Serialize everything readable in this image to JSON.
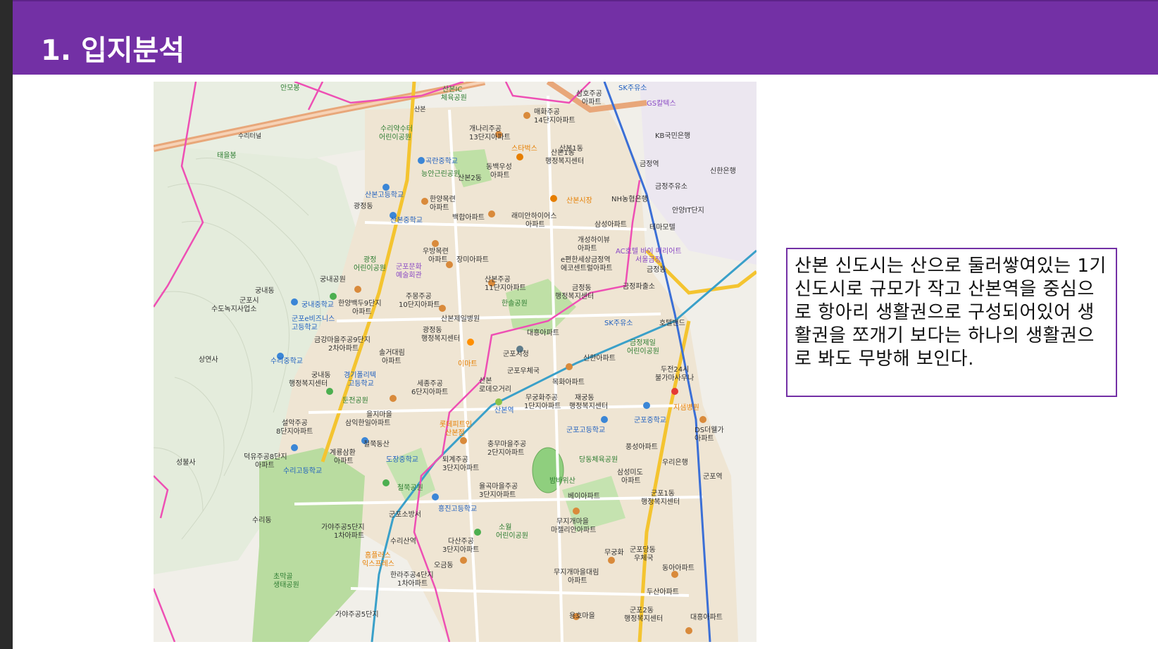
{
  "slide": {
    "title": "1. 입지분석",
    "description": "산본 신도시는 산으로 둘러쌓여있는 1기 신도시로 규모가 작고 산본역을 중심으로 항아리 생활권으로 구성되어있어 생활권을 쪼개기 보다는 하나의 생활권으로 봐도 무방해 보인다."
  },
  "map": {
    "labels": {
      "sanbon_ic": "산본IC",
      "sanbon_ic_park": "체육공원",
      "maehwa14": "매화주공",
      "maehwa14b": "14단지아파트",
      "gaenari13": "개나리주공",
      "gaenari13b": "13단지아파트",
      "sanbon1dong": "산본1동",
      "sanbon1center": "산본1동",
      "sanbon1center_b": "행정복지센터",
      "starbucks": "스타벅스",
      "gokran_ms": "곡란중학교",
      "dongbaek": "동백우성",
      "dongbaek_b": "아파트",
      "sanbon2dong": "산본2동",
      "neungan_park": "능안근린공원",
      "sanbon_hs": "산본고등학교",
      "hanyang": "한양목련",
      "hanyang_b": "아파트",
      "gwangjeong": "광정동",
      "sanbon_ms": "산본중학교",
      "baekhap": "백합아파트",
      "raemian": "래미안하이어스",
      "raemian_b": "아파트",
      "sanbon_market": "산본시장",
      "nh_bank": "NH농협은행",
      "samsung_apt": "삼성아파트",
      "temamotel": "테마모텔",
      "geumjeong_station": "금정역",
      "kb_bank": "KB국민은행",
      "sk_gas": "SK주유소",
      "gs_caltex": "GS칼텍스",
      "shinhan": "신한은행",
      "anyang_it": "안양IT단지",
      "woobang": "우방목련",
      "woobang_b": "아파트",
      "jangmi": "장미아파트",
      "gwangjeong_park": "광정",
      "gwangjeong_park_b": "어린이공원",
      "gunpo_culture": "군포문화",
      "gunpo_culture_b": "예술회관",
      "gungnae_park": "궁내공원",
      "gungnae_dong": "궁내동",
      "gunpo_office": "군포시",
      "gunpo_office_b": "수도녹지사업소",
      "gungnae_ms": "궁내중학교",
      "hanyang9": "한양백두9단지",
      "hanyang9_b": "아파트",
      "jumong10": "주몽주공",
      "jumong10_b": "10단지아파트",
      "sanbon11": "산본주공",
      "sanbon11_b": "11단지아파트",
      "hansol_park": "한솔공원",
      "geumjeong_dong": "금정동",
      "geumjeong_center": "행정복지센터",
      "gunpo_e_biz": "군포e비즈니스",
      "gunpo_e_biz_b": "고등학교",
      "sanbon_hospital": "산본제일병원",
      "geumgang9": "금강마을주공9단지",
      "geumgang9_b": "2차아파트",
      "gwangjeong_center": "광정동",
      "gwangjeong_center_b": "행정복지센터",
      "daeheung": "대흥아파트",
      "sangyeonsa": "상연사",
      "suri_ms": "수리중학교",
      "solgeo": "솔거대림",
      "solgeo_b": "아파트",
      "emart": "이마트",
      "gunpo_cityhall": "군포시청",
      "gunpo_post": "군포우체국",
      "shinhwa": "신한아파트",
      "sk_gas2": "SK주유소",
      "hotel": "호텔밴드",
      "gyeonggi_poly": "경기폴리텍",
      "gyeonggi_poly_b": "고등학교",
      "gungnae_center": "궁내동",
      "gungnae_center_b": "행정복지센터",
      "sejong6": "세종주공",
      "sejong6_b": "6단지아파트",
      "sanbon_lotte": "산본",
      "sanbon_lotte_b": "로데오거리",
      "mokhwa": "목화아파트",
      "dunjeon_park": "둔전공원",
      "eulji": "을지마을",
      "eulji_b": "삼익한일아파트",
      "sanbon_station": "산본역",
      "mugunghwa1": "무궁화주공",
      "mugunghwa1_b": "1단지아파트",
      "jaegung_center": "재궁동",
      "jaegung_center_b": "행정복지센터",
      "gunpo_hs": "군포고등학교",
      "gunpo_ms": "군포중학교",
      "jisaem": "지샘병원",
      "ds_apt": "DS더웰가",
      "ds_apt_b": "아파트",
      "seolak8": "설악주공",
      "seolak8_b": "8단지아파트",
      "lotte_fit": "롯데피트인",
      "lotte_fit_b": "산본점",
      "cheolchuk": "철쭉동산",
      "dojang_ms": "도장중학교",
      "chungmu2": "충무마을주공",
      "chungmu2_b": "2단지아파트",
      "pungseong": "풍성아파트",
      "dangdong_park": "당동체육공원",
      "woori": "우리은행",
      "seongbulsa": "성불사",
      "deokyu8": "덕유주공8단지",
      "deokyu8_b": "아파트",
      "suri_hs": "수리고등학교",
      "gyeryong": "계룡삼환",
      "gyeryong_b": "아파트",
      "toegye3": "퇴계주공",
      "toegye3_b": "3단지아파트",
      "sammido": "삼성미도",
      "sammido_b": "아파트",
      "gunpo_station": "군포역",
      "cheoljuk_park": "철쭉공원",
      "yulgok3": "율곡마을주공",
      "yulgok3_b": "3단지아파트",
      "bambwisan": "밤바위산",
      "bei_apt": "베이아파트",
      "gunpo1_center": "군포1동",
      "gunpo1_center_b": "행정복지센터",
      "suridong": "수리동",
      "gunpo_fire": "군포소방서",
      "heungjin_hs": "흥진고등학교",
      "gaya5": "가야주공5단지",
      "gaya5_b": "1차아파트",
      "surisan_station": "수리산역",
      "soweol_park": "소월",
      "soweol_park_b": "어린이공원",
      "mujigae": "무지개마을",
      "mujigae_b": "마젤리안아파트",
      "dasan3": "다산주공",
      "dasan3_b": "3단지아파트",
      "homeplus": "홈플러스",
      "homeplus_b": "익스프레스",
      "ogeum": "오금동",
      "mugunghwa": "무궁화",
      "gunpo_dangdong": "군포당동",
      "gunpo_dangdong_b": "우체국",
      "donga": "동아아파트",
      "choman_park": "초막골",
      "choman_park_b": "생태공원",
      "halla4": "한라주공4단지",
      "halla4_b": "1차아파트",
      "mujigae_daelim": "무지개마을대림",
      "mujigae_daelim_b": "아파트",
      "dusan": "두산아파트",
      "gaya5_2": "가야주공5단지",
      "yongho": "용호마을",
      "gunpo2_center": "군포2동",
      "gunpo2_center_b": "행정복지센터",
      "daeheung2": "대흥아파트",
      "ac_hotel": "AC호텔 바이 메리어트",
      "ac_hotel_b": "서울금정",
      "geumjeong_dong2": "금정동",
      "geumjeong_police": "금정파출소",
      "geumjeong_gas": "금정주유소",
      "geumjeong_park": "금정제일",
      "geumjeong_park_b": "어린이공원",
      "dujeon24": "두전24시",
      "dujeon24_b": "불가마사우나",
      "sanbon_seyeong": "e편한세상금정역",
      "sanbon_seyeong_b": "에코센트럴아파트",
      "gaeseong": "개성하이뷰",
      "gaeseong_b": "아파트",
      "sanbon_park_top": "안모봉",
      "suri_park": "수리약수터",
      "suri_park_b": "어린이공원",
      "suri_tunnel": "수리터널",
      "taeeulbong": "태을봉",
      "samho": "삼호주공",
      "samho_b": "아파트",
      "sanbon_label": "산본"
    },
    "colors": {
      "boundary": "#ee4fb4",
      "highway": "#e8a77a",
      "rail_blue": "#3b6fd6",
      "rail_teal": "#3aa0c9",
      "road_yellow": "#f4c430",
      "forest": "#dce9d2",
      "park": "#a9d48f",
      "urban": "#efe3cf"
    }
  }
}
